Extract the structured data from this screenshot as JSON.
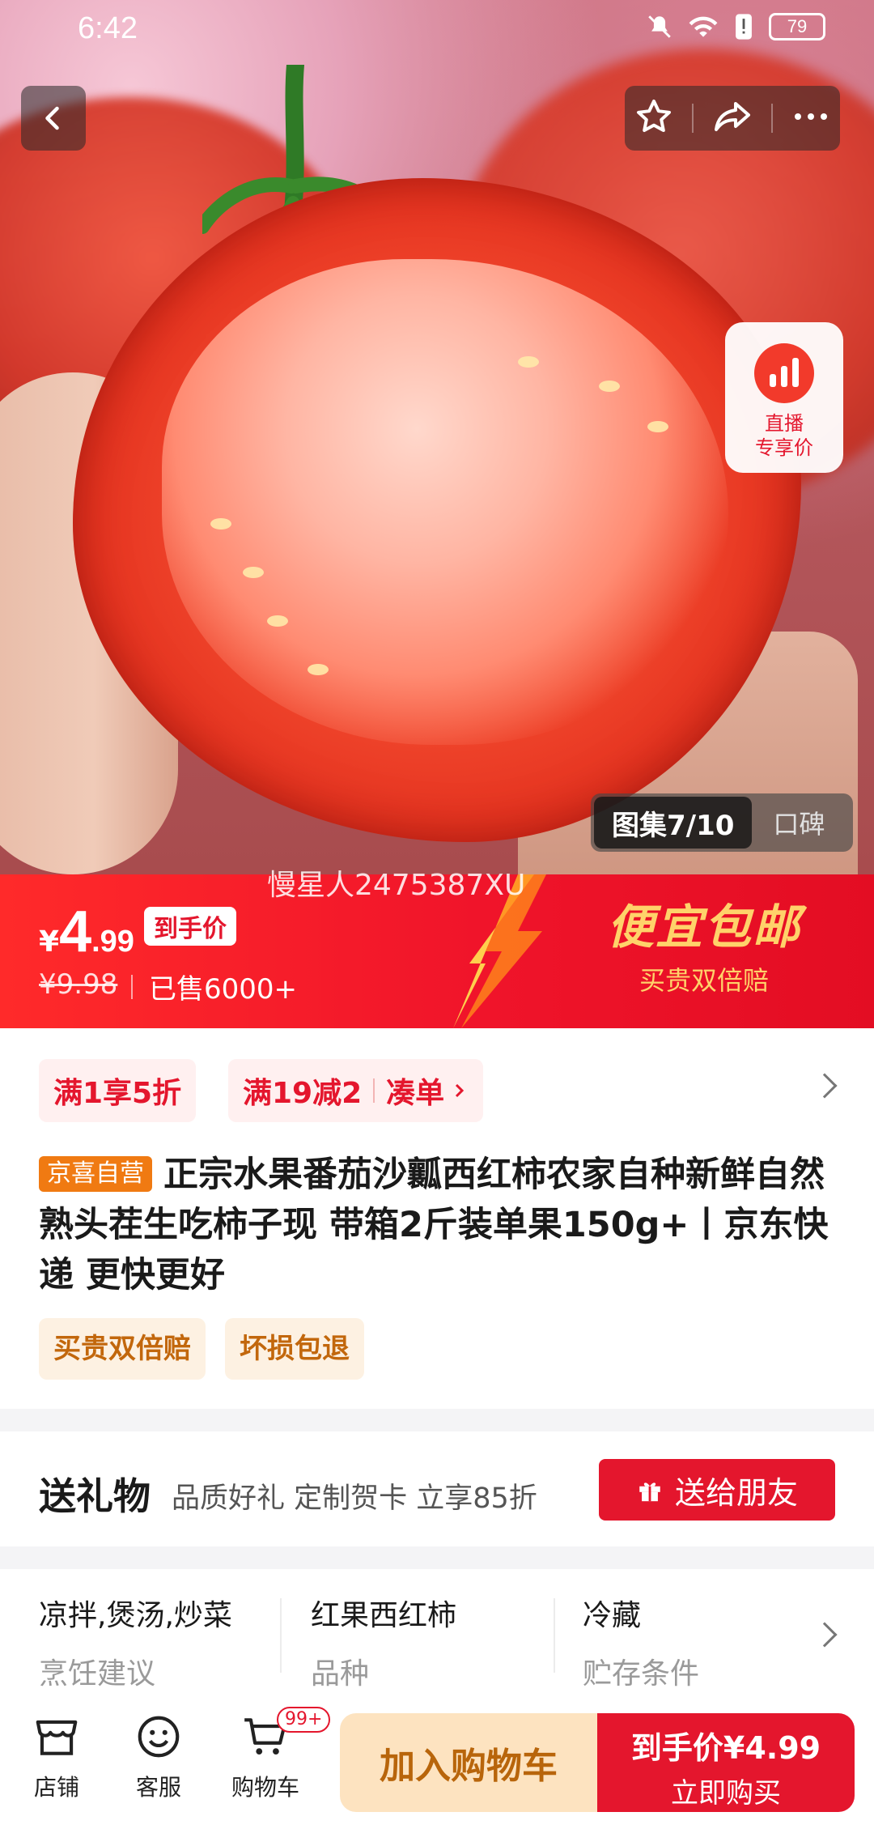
{
  "status": {
    "time": "6:42",
    "battery": "79"
  },
  "gallery": {
    "counter": "图集7/10",
    "reviews_tab": "口碑"
  },
  "live_badge": {
    "line1": "直播",
    "line2": "专享价"
  },
  "watermark": "慢星人2475387XU",
  "price": {
    "currency": "¥",
    "integer": "4",
    "decimal": ".99",
    "tag": "到手价",
    "original": "¥9.98",
    "sold": "已售6000+",
    "promo_title": "便宜包邮",
    "promo_sub": "买贵双倍赔"
  },
  "coupons": [
    {
      "text": "满1享5折"
    },
    {
      "text": "满19减2",
      "action": "凑单"
    }
  ],
  "title": {
    "tag": "京喜自营",
    "text": "正宗水果番茄沙瓤西红柿农家自种新鲜自然熟头茬生吃柿子现 带箱2斤装单果150g+丨京东快递 更快更好"
  },
  "badges": [
    "买贵双倍赔",
    "坏损包退"
  ],
  "gift": {
    "title": "送礼物",
    "desc": "品质好礼 定制贺卡 立享85折",
    "button": "送给朋友"
  },
  "attributes": [
    {
      "value": "凉拌,煲汤,炒菜",
      "key": "烹饪建议"
    },
    {
      "value": "红果西红柿",
      "key": "品种"
    },
    {
      "value": "冷藏",
      "key": "贮存条件"
    }
  ],
  "bottom_bar": {
    "store": "店铺",
    "service": "客服",
    "cart": "购物车",
    "cart_count": "99+",
    "add_to_cart": "加入购物车",
    "buy_top": "到手价¥4.99",
    "buy_bottom": "立即购买"
  },
  "colors": {
    "accent": "#e4162d",
    "promo_gold": "#ffd26a",
    "self_tag": "#f07a12"
  }
}
